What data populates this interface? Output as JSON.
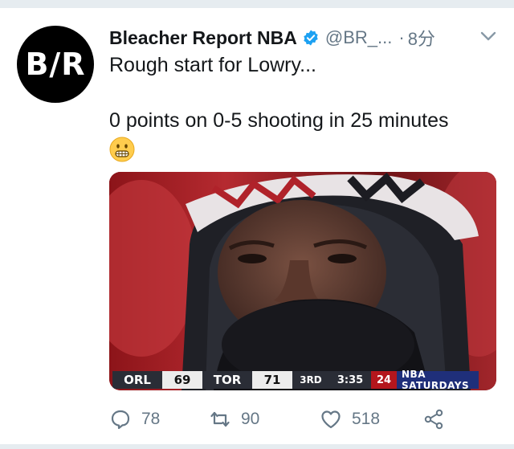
{
  "tweet": {
    "avatar_text": "B/R",
    "display_name": "Bleacher Report NBA",
    "handle": "@BR_...",
    "separator": "·",
    "time": "8分",
    "text_line1": "Rough start for Lowry...",
    "text_line2": "0 points on 0-5 shooting in 25 minutes",
    "emoji": "grimacing-face",
    "accent_color": "#1da1f2"
  },
  "scorebug": {
    "team1": "ORL",
    "score1": "69",
    "team2": "TOR",
    "score2": "71",
    "quarter": "3RD",
    "clock": "3:35",
    "shot_clock": "24",
    "brand": "NBA SATURDAYS"
  },
  "actions": {
    "reply_count": "78",
    "retweet_count": "90",
    "like_count": "518"
  }
}
